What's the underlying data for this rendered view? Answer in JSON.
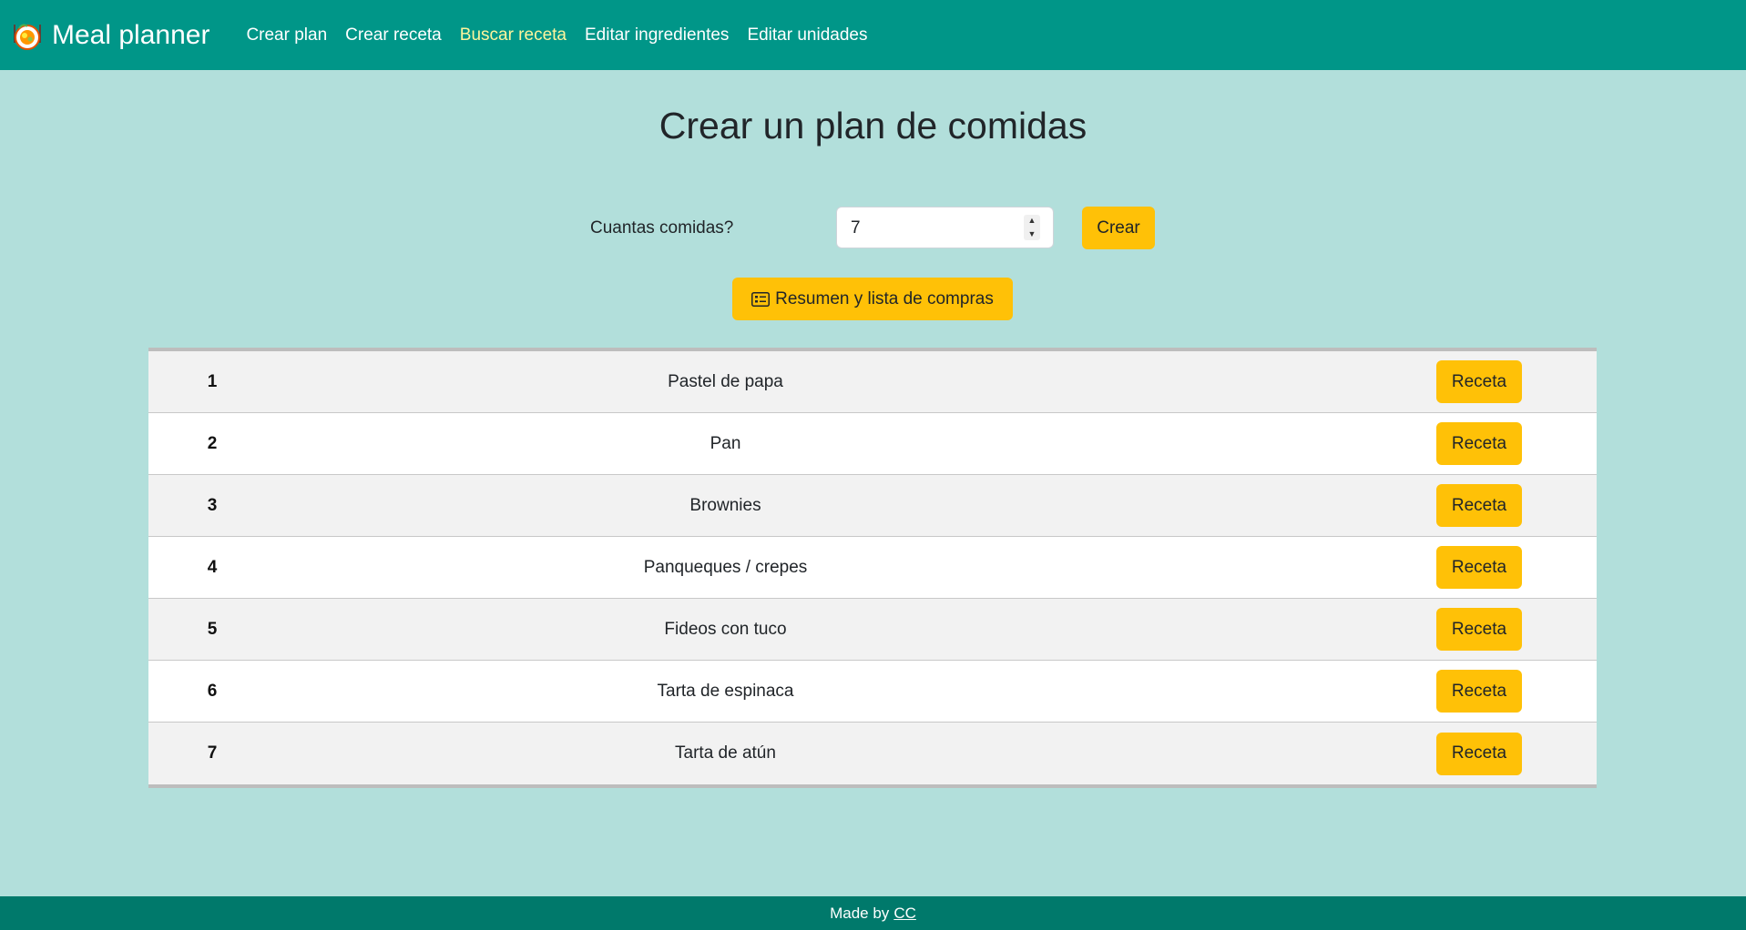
{
  "navbar": {
    "brand_icon": "food-bowl-icon",
    "brand": "Meal planner",
    "links": [
      {
        "label": "Crear plan",
        "active": false
      },
      {
        "label": "Crear receta",
        "active": false
      },
      {
        "label": "Buscar receta",
        "active": true
      },
      {
        "label": "Editar ingredientes",
        "active": false
      },
      {
        "label": "Editar unidades",
        "active": false
      }
    ]
  },
  "main": {
    "title": "Crear un plan de comidas",
    "form": {
      "label": "Cuantas comidas?",
      "value": "7",
      "submit_label": "Crear"
    },
    "summary_button": {
      "icon": "checklist-icon",
      "label": "Resumen y lista de compras"
    }
  },
  "plan": {
    "action_label": "Receta",
    "rows": [
      {
        "num": "1",
        "name": "Pastel de papa"
      },
      {
        "num": "2",
        "name": "Pan"
      },
      {
        "num": "3",
        "name": "Brownies"
      },
      {
        "num": "4",
        "name": "Panqueques / crepes"
      },
      {
        "num": "5",
        "name": "Fideos con tuco"
      },
      {
        "num": "6",
        "name": "Tarta de espinaca"
      },
      {
        "num": "7",
        "name": "Tarta de atún"
      }
    ]
  },
  "footer": {
    "text": "Made by",
    "link": "CC"
  },
  "colors": {
    "navbar": "#009688",
    "background": "#b2dfdb",
    "accent": "#ffc107",
    "active_link": "#fff59d",
    "footer": "#00796b"
  }
}
